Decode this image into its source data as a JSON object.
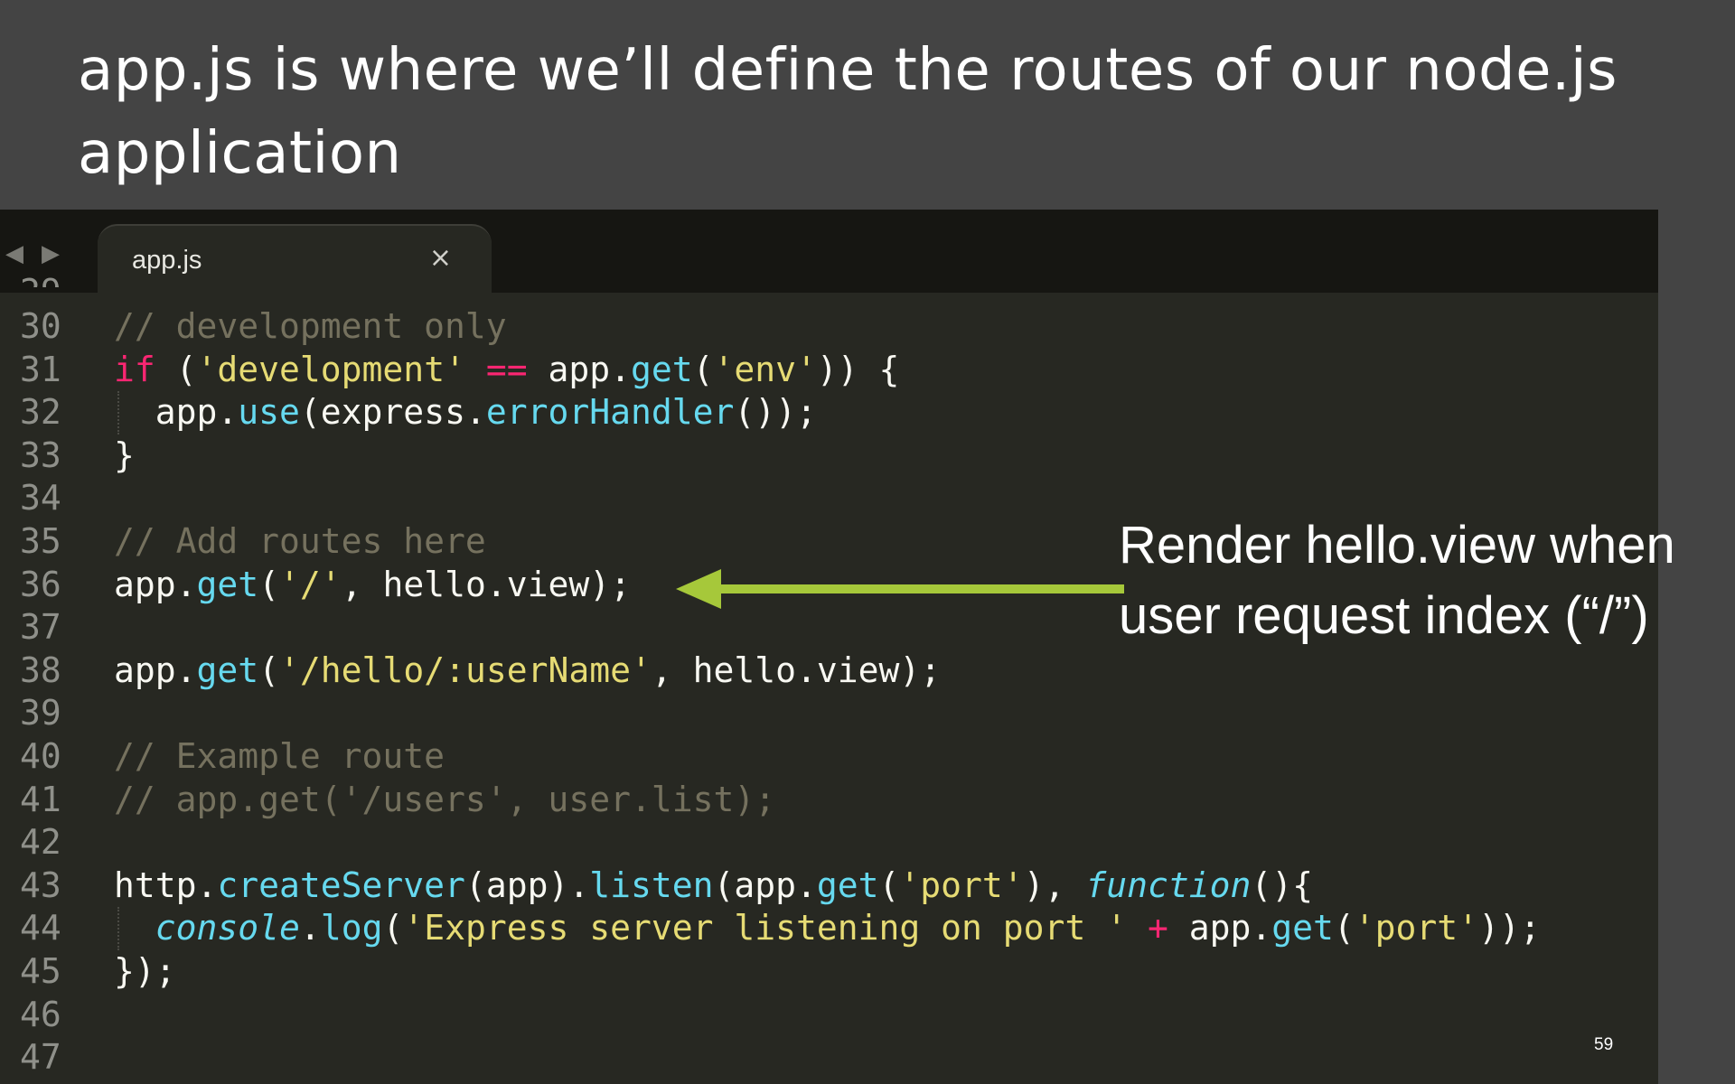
{
  "slide": {
    "title": "app.js is where we’ll define the routes of our node.js application",
    "annotation_line1": "Render hello.view when",
    "annotation_line2": "user request index (“/”)",
    "page_number": "59"
  },
  "editor": {
    "nav_back": "◀",
    "nav_forward": "▶",
    "tab_label": "app.js",
    "tab_close": "×",
    "colors": {
      "background": "#272822",
      "comment": "#75715e",
      "keyword": "#f92672",
      "string": "#e6db74",
      "function": "#66d9ef",
      "text": "#f8f8f2",
      "arrow": "#a6c83a"
    }
  },
  "code_lines": [
    {
      "num": "30",
      "segs": [
        [
          "c",
          "// development only"
        ]
      ]
    },
    {
      "num": "31",
      "segs": [
        [
          "k",
          "if"
        ],
        [
          "w",
          " ("
        ],
        [
          "s",
          "'development'"
        ],
        [
          "w",
          " "
        ],
        [
          "k",
          "=="
        ],
        [
          "w",
          " app."
        ],
        [
          "f",
          "get"
        ],
        [
          "w",
          "("
        ],
        [
          "s",
          "'env'"
        ],
        [
          "w",
          ")) {"
        ]
      ]
    },
    {
      "num": "32",
      "segs": [
        [
          "w",
          "  app."
        ],
        [
          "f",
          "use"
        ],
        [
          "w",
          "(express."
        ],
        [
          "f",
          "errorHandler"
        ],
        [
          "w",
          "());"
        ]
      ]
    },
    {
      "num": "33",
      "segs": [
        [
          "w",
          "}"
        ]
      ]
    },
    {
      "num": "34",
      "segs": []
    },
    {
      "num": "35",
      "segs": [
        [
          "c",
          "// Add routes here"
        ]
      ]
    },
    {
      "num": "36",
      "segs": [
        [
          "w",
          "app."
        ],
        [
          "f",
          "get"
        ],
        [
          "w",
          "("
        ],
        [
          "s",
          "'/'"
        ],
        [
          "w",
          ", hello.view);"
        ]
      ]
    },
    {
      "num": "37",
      "segs": []
    },
    {
      "num": "38",
      "segs": [
        [
          "w",
          "app."
        ],
        [
          "f",
          "get"
        ],
        [
          "w",
          "("
        ],
        [
          "s",
          "'/hello/:userName'"
        ],
        [
          "w",
          ", hello.view);"
        ]
      ]
    },
    {
      "num": "39",
      "segs": []
    },
    {
      "num": "40",
      "segs": [
        [
          "c",
          "// Example route"
        ]
      ]
    },
    {
      "num": "41",
      "segs": [
        [
          "c",
          "// app.get('/users', user.list);"
        ]
      ]
    },
    {
      "num": "42",
      "segs": []
    },
    {
      "num": "43",
      "segs": [
        [
          "w",
          "http."
        ],
        [
          "f",
          "createServer"
        ],
        [
          "w",
          "(app)."
        ],
        [
          "f",
          "listen"
        ],
        [
          "w",
          "(app."
        ],
        [
          "f",
          "get"
        ],
        [
          "w",
          "("
        ],
        [
          "s",
          "'port'"
        ],
        [
          "w",
          "), "
        ],
        [
          "i",
          "function"
        ],
        [
          "w",
          "(){"
        ]
      ]
    },
    {
      "num": "44",
      "segs": [
        [
          "w",
          "  "
        ],
        [
          "i",
          "console"
        ],
        [
          "w",
          "."
        ],
        [
          "f",
          "log"
        ],
        [
          "w",
          "("
        ],
        [
          "s",
          "'Express server listening on port '"
        ],
        [
          "w",
          " "
        ],
        [
          "k",
          "+"
        ],
        [
          "w",
          " app."
        ],
        [
          "f",
          "get"
        ],
        [
          "w",
          "("
        ],
        [
          "s",
          "'port'"
        ],
        [
          "w",
          "));"
        ]
      ]
    },
    {
      "num": "45",
      "segs": [
        [
          "w",
          "});"
        ]
      ]
    },
    {
      "num": "46",
      "segs": []
    },
    {
      "num": "47",
      "segs": []
    }
  ]
}
